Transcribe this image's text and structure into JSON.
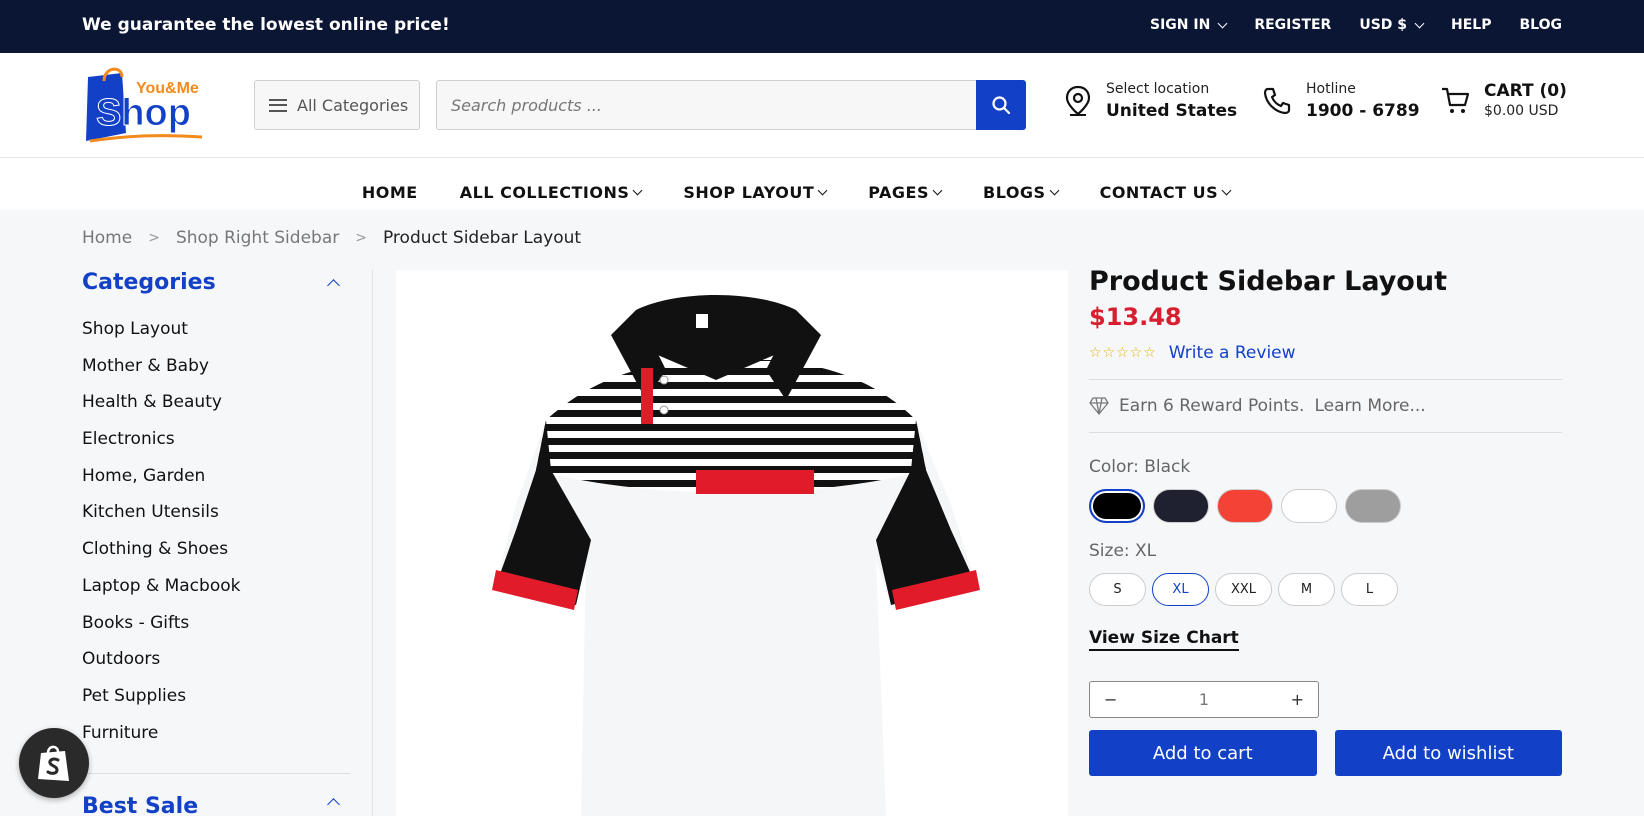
{
  "topbar": {
    "promo": "We guarantee the lowest online price!",
    "sign_in": "SIGN IN",
    "register": "REGISTER",
    "currency": "USD $",
    "help": "HELP",
    "blog": "BLOG"
  },
  "header": {
    "logo_top": "You&Me",
    "logo_main": "Shop",
    "all_categories": "All Categories",
    "search_placeholder": "Search products ...",
    "location_label": "Select location",
    "location_value": "United States",
    "hotline_label": "Hotline",
    "hotline_value": "1900 - 6789",
    "cart_label": "CART (0)",
    "cart_total": "$0.00 USD"
  },
  "nav": {
    "items": [
      "HOME",
      "ALL COLLECTIONS",
      "SHOP LAYOUT",
      "PAGES",
      "BLOGS",
      "CONTACT US"
    ]
  },
  "breadcrumb": {
    "home": "Home",
    "parent": "Shop Right Sidebar",
    "current": "Product Sidebar Layout"
  },
  "sidebar": {
    "title": "Categories",
    "categories": [
      "Shop Layout",
      "Mother & Baby",
      "Health & Beauty",
      "Electronics",
      "Home, Garden",
      "Kitchen Utensils",
      "Clothing & Shoes",
      "Laptop & Macbook",
      "Books - Gifts",
      "Outdoors",
      "Pet Supplies",
      "Furniture"
    ],
    "best_sale": "Best Sale"
  },
  "product": {
    "title": "Product Sidebar Layout",
    "price": "$13.48",
    "rating_stars": "☆☆☆☆☆",
    "write_review": "Write a Review",
    "reward": "Earn 6 Reward Points.",
    "learn_more": "Learn More...",
    "color_label": "Color: Black",
    "colors": [
      "#000000",
      "#1f2030",
      "#f44336",
      "#ffffff",
      "#9e9e9e"
    ],
    "size_label": "Size: XL",
    "sizes": [
      "S",
      "XL",
      "XXL",
      "M",
      "L"
    ],
    "selected_size": "XL",
    "size_chart": "View Size Chart",
    "quantity": "1",
    "qty_minus": "−",
    "qty_plus": "+",
    "add_to_cart": "Add to cart",
    "add_to_wishlist": "Add to wishlist"
  },
  "colors": {
    "brand_blue": "#1241c8",
    "topbar_bg": "#0b1534",
    "price_red": "#d81f30"
  }
}
